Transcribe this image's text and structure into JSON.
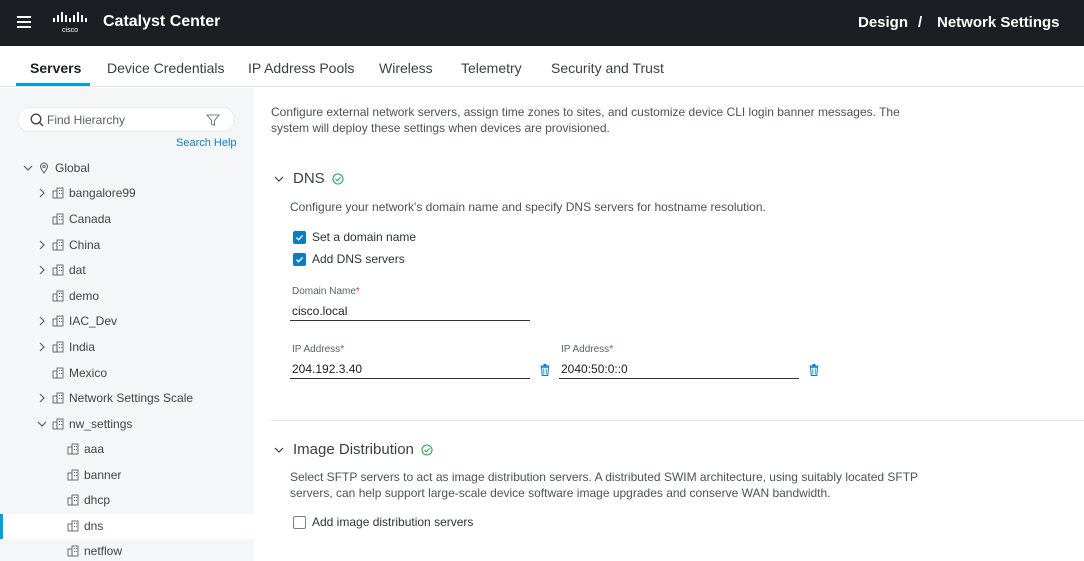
{
  "header": {
    "app_title": "Catalyst Center",
    "logo_text": "cisco",
    "breadcrumb_parent": "Design",
    "breadcrumb_sep": "/",
    "breadcrumb_current": "Network Settings"
  },
  "tabs": [
    {
      "label": "Servers",
      "active": true
    },
    {
      "label": "Device Credentials"
    },
    {
      "label": "IP Address Pools"
    },
    {
      "label": "Wireless"
    },
    {
      "label": "Telemetry"
    },
    {
      "label": "Security and Trust"
    }
  ],
  "sidebar": {
    "search_placeholder": "Find Hierarchy",
    "search_help": "Search Help",
    "tree": [
      {
        "label": "Global",
        "level": 0,
        "expanded": true,
        "icon": "location-pin-icon"
      },
      {
        "label": "bangalore99",
        "level": 1,
        "expandable": true,
        "icon": "building-icon"
      },
      {
        "label": "Canada",
        "level": 1,
        "expandable": false,
        "icon": "building-icon"
      },
      {
        "label": "China",
        "level": 1,
        "expandable": true,
        "icon": "building-icon"
      },
      {
        "label": "dat",
        "level": 1,
        "expandable": true,
        "icon": "building-icon"
      },
      {
        "label": "demo",
        "level": 1,
        "expandable": false,
        "icon": "building-icon"
      },
      {
        "label": "IAC_Dev",
        "level": 1,
        "expandable": true,
        "icon": "building-icon"
      },
      {
        "label": "India",
        "level": 1,
        "expandable": true,
        "icon": "building-icon"
      },
      {
        "label": "Mexico",
        "level": 1,
        "expandable": false,
        "icon": "building-icon"
      },
      {
        "label": "Network Settings Scale",
        "level": 1,
        "expandable": true,
        "icon": "building-icon"
      },
      {
        "label": "nw_settings",
        "level": 1,
        "expanded": true,
        "icon": "building-icon"
      },
      {
        "label": "aaa",
        "level": 2,
        "icon": "building-icon"
      },
      {
        "label": "banner",
        "level": 2,
        "icon": "building-icon"
      },
      {
        "label": "dhcp",
        "level": 2,
        "icon": "building-icon"
      },
      {
        "label": "dns",
        "level": 2,
        "icon": "building-icon",
        "selected": true
      },
      {
        "label": "netflow",
        "level": 2,
        "icon": "building-icon"
      }
    ]
  },
  "main": {
    "intro": "Configure external network servers, assign time zones to sites, and customize device CLI login banner messages. The system will deploy these settings when devices are provisioned.",
    "dns": {
      "title": "DNS",
      "description": "Configure your network's domain name and specify DNS servers for hostname resolution.",
      "set_domain_label": "Set a domain name",
      "set_domain_checked": true,
      "add_dns_label": "Add DNS servers",
      "add_dns_checked": true,
      "domain_name_label": "Domain Name",
      "domain_name_value": "cisco.local",
      "ip_label": "IP Address",
      "ip1_value": "204.192.3.40",
      "ip2_value": "2040:50:0::0",
      "required_mark": "*"
    },
    "image_distribution": {
      "title": "Image Distribution",
      "description": "Select SFTP servers to act as image distribution servers. A distributed SWIM architecture, using suitably located SFTP servers, can help support large-scale device software image upgrades and conserve WAN bandwidth.",
      "add_label": "Add image distribution servers",
      "add_checked": false
    }
  },
  "colors": {
    "header_bg": "#1b1e23",
    "accent": "#049fd9",
    "link": "#0d7cc1",
    "success": "#2ca55a",
    "required": "#d0393a"
  }
}
